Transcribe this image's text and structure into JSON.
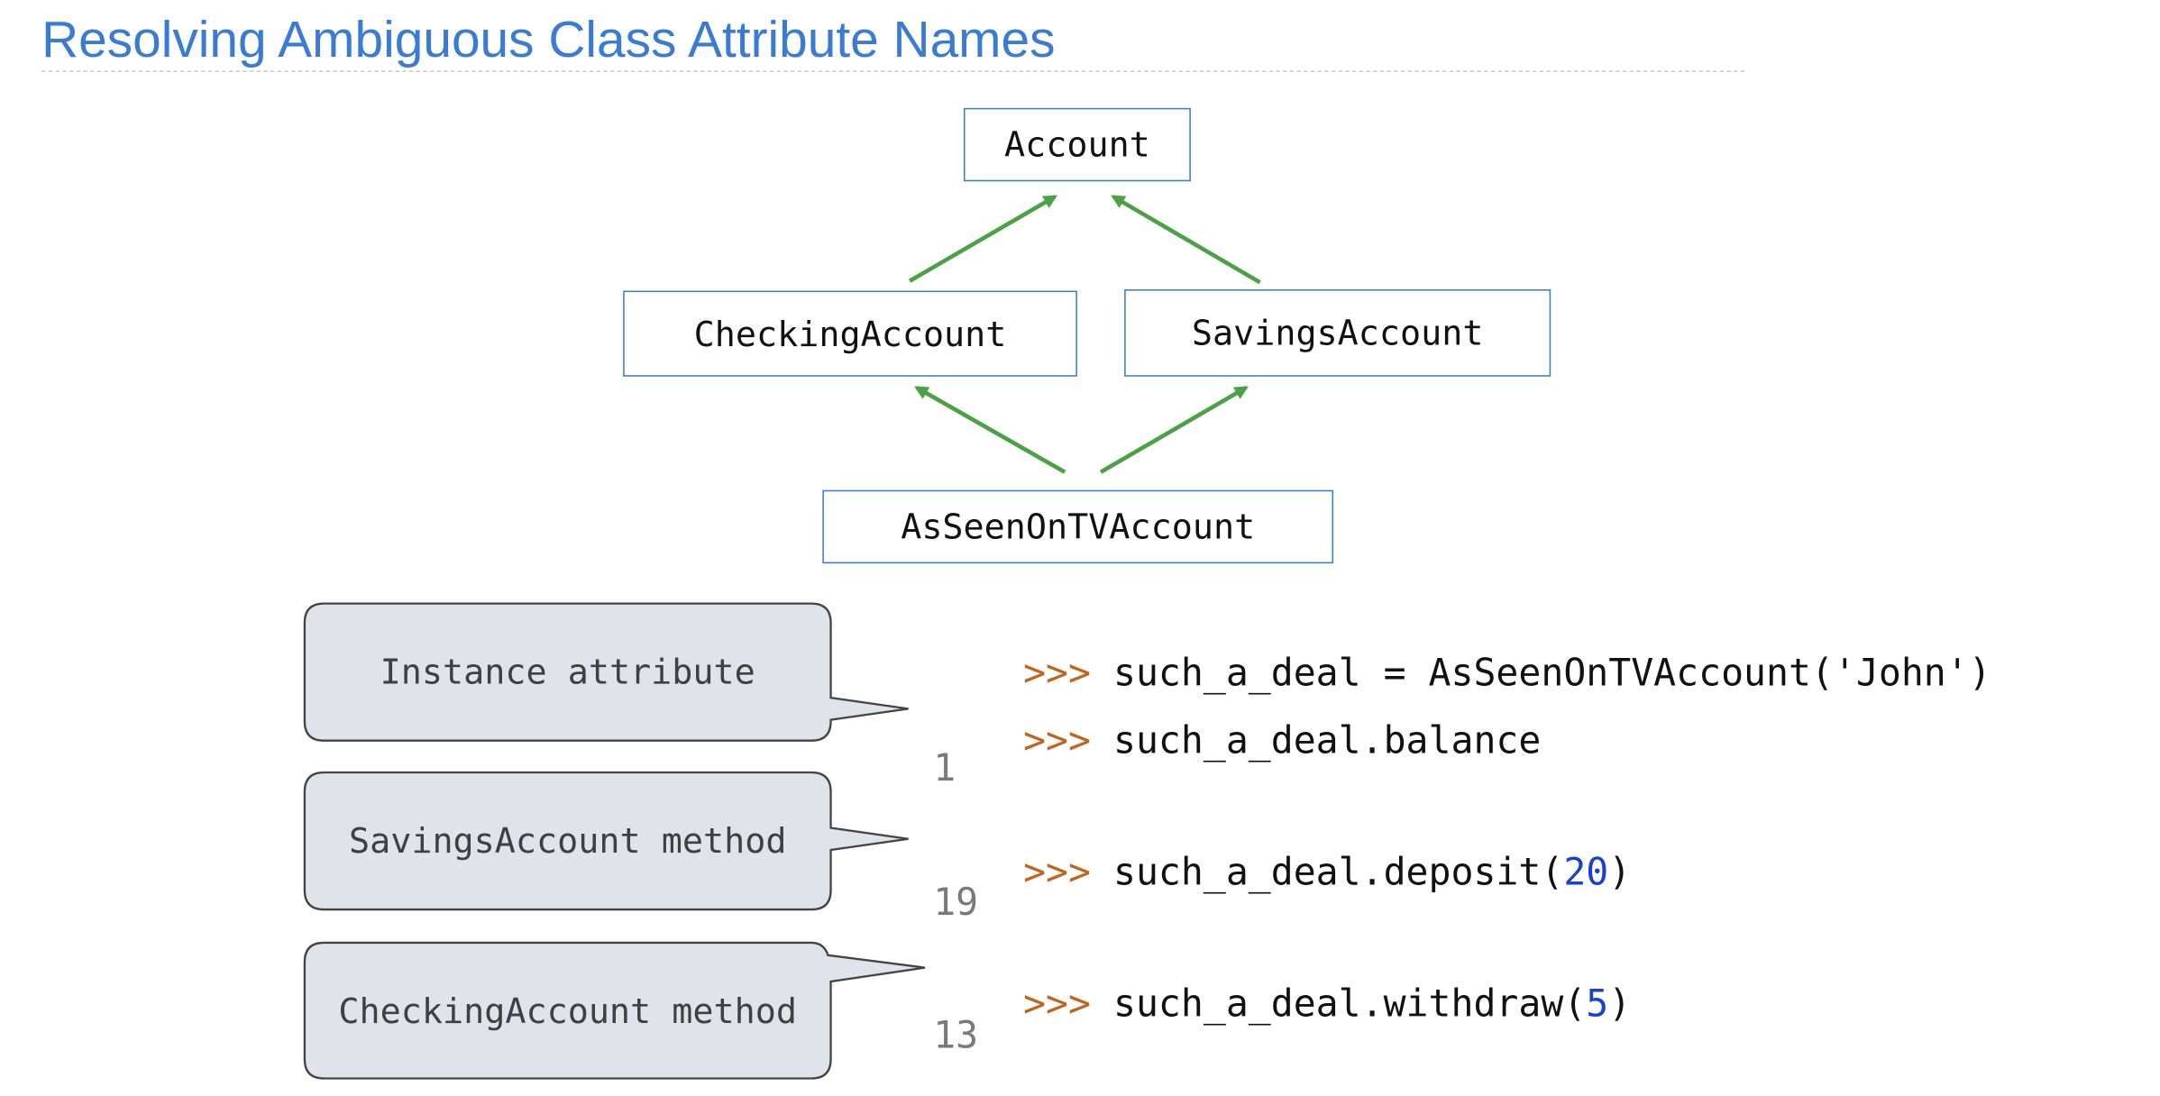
{
  "title": "Resolving Ambiguous Class Attribute Names",
  "diagram": {
    "classes": {
      "account": "Account",
      "checking": "CheckingAccount",
      "savings": "SavingsAccount",
      "asseen": "AsSeenOnTVAccount"
    },
    "edges": [
      {
        "from": "CheckingAccount",
        "to": "Account"
      },
      {
        "from": "SavingsAccount",
        "to": "Account"
      },
      {
        "from": "AsSeenOnTVAccount",
        "to": "CheckingAccount"
      },
      {
        "from": "AsSeenOnTVAccount",
        "to": "SavingsAccount"
      }
    ],
    "colors": {
      "box_border": "#3a7bd5",
      "arrow": "#4aa245",
      "title": "#3a7bd5",
      "callout_fill": "#dfe3ea",
      "prompt": "#c0641e",
      "number": "#1a3fd6",
      "output": "#7a7a7a"
    }
  },
  "callouts": [
    {
      "label": "Instance attribute"
    },
    {
      "label": "SavingsAccount method"
    },
    {
      "label": "CheckingAccount method"
    }
  ],
  "session": {
    "prompt": ">>>",
    "lines": [
      {
        "code": "such_a_deal = AsSeenOnTVAccount('John')"
      },
      {
        "code": "such_a_deal.balance"
      },
      {
        "output": "1"
      },
      {
        "code_pre": "such_a_deal.deposit(",
        "num": "20",
        "code_post": ")"
      },
      {
        "output": "19"
      },
      {
        "code_pre": "such_a_deal.withdraw(",
        "num": "5",
        "code_post": ")"
      },
      {
        "output": "13"
      }
    ]
  }
}
